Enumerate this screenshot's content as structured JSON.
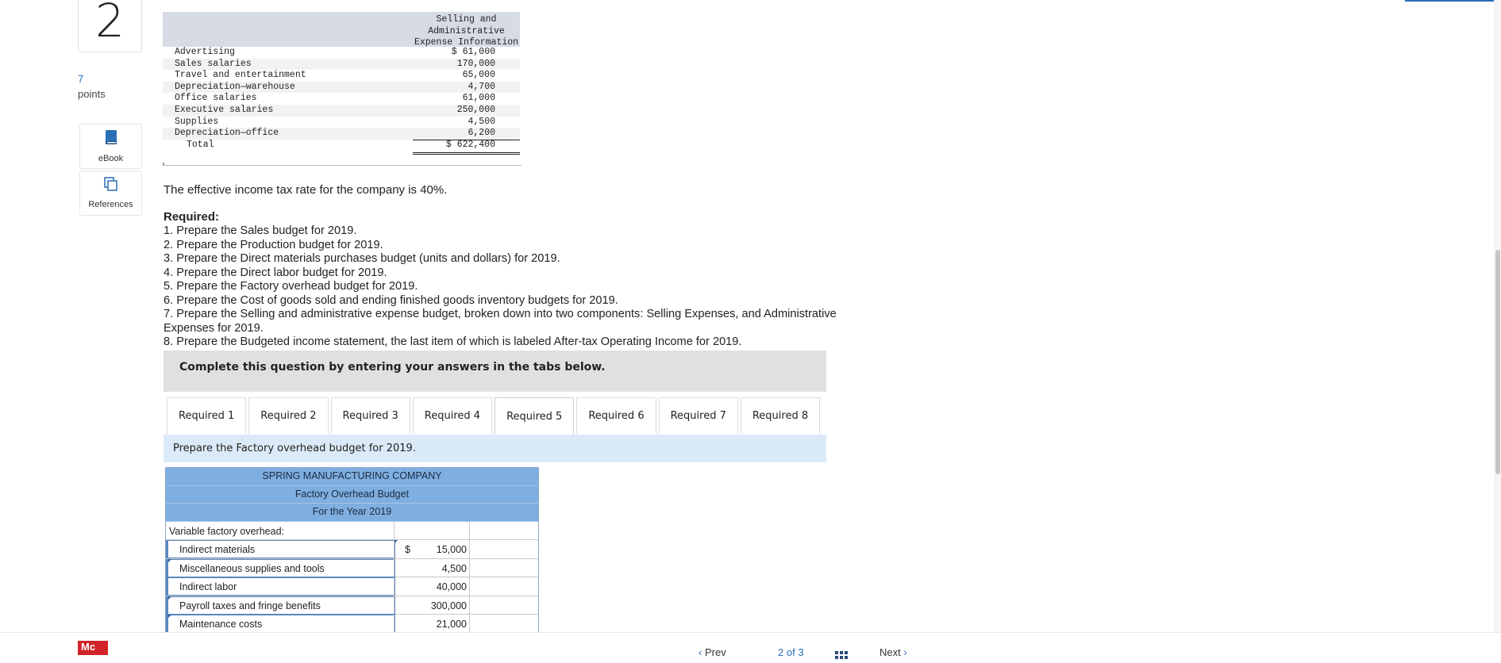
{
  "question": {
    "number": "2",
    "points_value": "7",
    "points_label": "points"
  },
  "side_buttons": {
    "ebook": "eBook",
    "references": "References"
  },
  "sa_table": {
    "header": [
      "Selling and",
      "Administrative",
      "Expense Information"
    ],
    "rows": [
      {
        "label": "Advertising",
        "amount": "$  61,000"
      },
      {
        "label": "Sales salaries",
        "amount": "170,000"
      },
      {
        "label": "Travel and entertainment",
        "amount": "65,000"
      },
      {
        "label": "Depreciation—warehouse",
        "amount": "4,700"
      },
      {
        "label": "Office salaries",
        "amount": "61,000"
      },
      {
        "label": "Executive salaries",
        "amount": "250,000"
      },
      {
        "label": "Supplies",
        "amount": "4,500"
      },
      {
        "label": "Depreciation—office",
        "amount": "6,200"
      }
    ],
    "total": {
      "label": "Total",
      "amount": "$ 622,400"
    }
  },
  "tax_text": "The effective income tax rate for the company is 40%.",
  "required_heading": "Required:",
  "required_items": [
    "1. Prepare the Sales budget for 2019.",
    "2. Prepare the Production budget for 2019.",
    "3. Prepare the Direct materials purchases budget (units and dollars) for 2019.",
    "4. Prepare the Direct labor budget for 2019.",
    "5. Prepare the Factory overhead budget for 2019.",
    "6. Prepare the Cost of goods sold and ending finished goods inventory budgets for 2019.",
    "7. Prepare the Selling and administrative expense budget, broken down into two components: Selling Expenses, and Administrative Expenses for 2019.",
    "8. Prepare the Budgeted income statement, the last item of which is labeled After-tax Operating Income for 2019."
  ],
  "complete_text": "Complete this question by entering your answers in the tabs below.",
  "tabs": [
    "Required 1",
    "Required 2",
    "Required 3",
    "Required 4",
    "Required 5",
    "Required 6",
    "Required 7",
    "Required 8"
  ],
  "active_tab": "Required 5",
  "prompt": "Prepare the Factory overhead budget for 2019.",
  "fo_budget": {
    "company": "SPRING MANUFACTURING COMPANY",
    "title": "Factory Overhead Budget",
    "period": "For the Year 2019",
    "section_label": "Variable factory overhead:",
    "currency_symbol": "$",
    "items": [
      {
        "label": "Indirect materials",
        "value": "15,000"
      },
      {
        "label": "Miscellaneous supplies and tools",
        "value": "4,500"
      },
      {
        "label": "Indirect labor",
        "value": "40,000"
      },
      {
        "label": "Payroll taxes and fringe benefits",
        "value": "300,000"
      },
      {
        "label": "Maintenance costs",
        "value": "21,000"
      }
    ]
  },
  "footer": {
    "logo": "Mc",
    "prev": "Prev",
    "page_current": "2",
    "page_of": "of",
    "page_total": "3",
    "next": "Next"
  },
  "colors": {
    "accent": "#2a6fb5",
    "table_header": "#7faee0",
    "prompt_bg": "#dbeaf8",
    "logo_red": "#d2232a"
  }
}
